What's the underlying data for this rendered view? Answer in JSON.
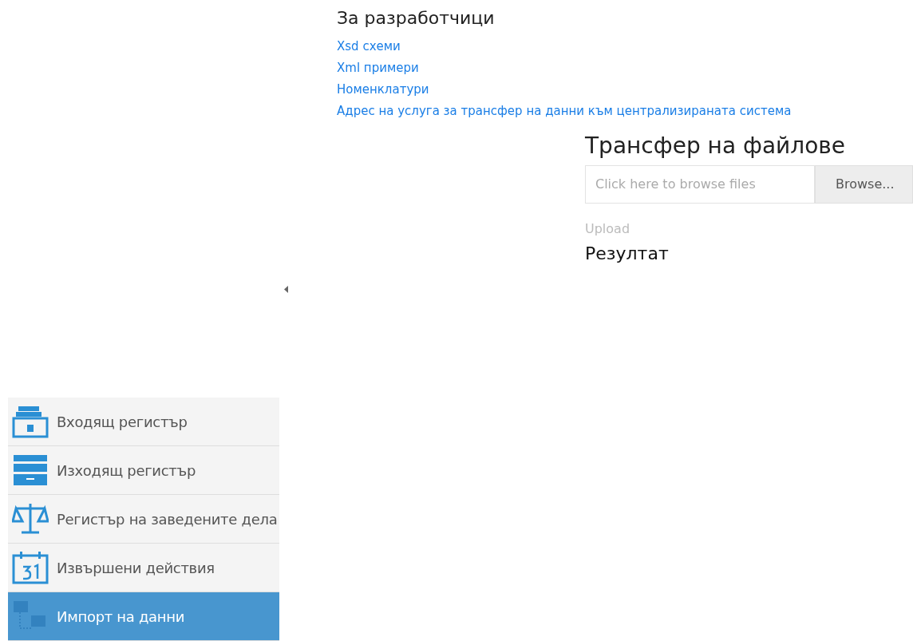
{
  "developers": {
    "title": "За разработчици",
    "links": [
      "Xsd схеми",
      "Xml примери",
      "Номенклатури",
      "Адрес на услуга за трансфер на данни към централизираната система"
    ]
  },
  "transfer": {
    "title": "Трансфер на файлове",
    "file_field": {
      "placeholder": "Click here to browse files"
    },
    "browse_button": "Browse...",
    "upload_button": {
      "label": "Upload",
      "disabled": true
    },
    "result_title": "Резултат"
  },
  "sidebar": {
    "items": [
      {
        "kind": "inbox",
        "label": "Входящ регистър",
        "selected": false
      },
      {
        "kind": "outbox",
        "label": "Изходящ регистър",
        "selected": false
      },
      {
        "kind": "scales",
        "label": "Регистър на заведените дела",
        "selected": false
      },
      {
        "kind": "calendar",
        "label": "Извършени действия",
        "selected": false
      },
      {
        "kind": "network",
        "label": "Импорт на данни",
        "selected": true
      }
    ]
  }
}
